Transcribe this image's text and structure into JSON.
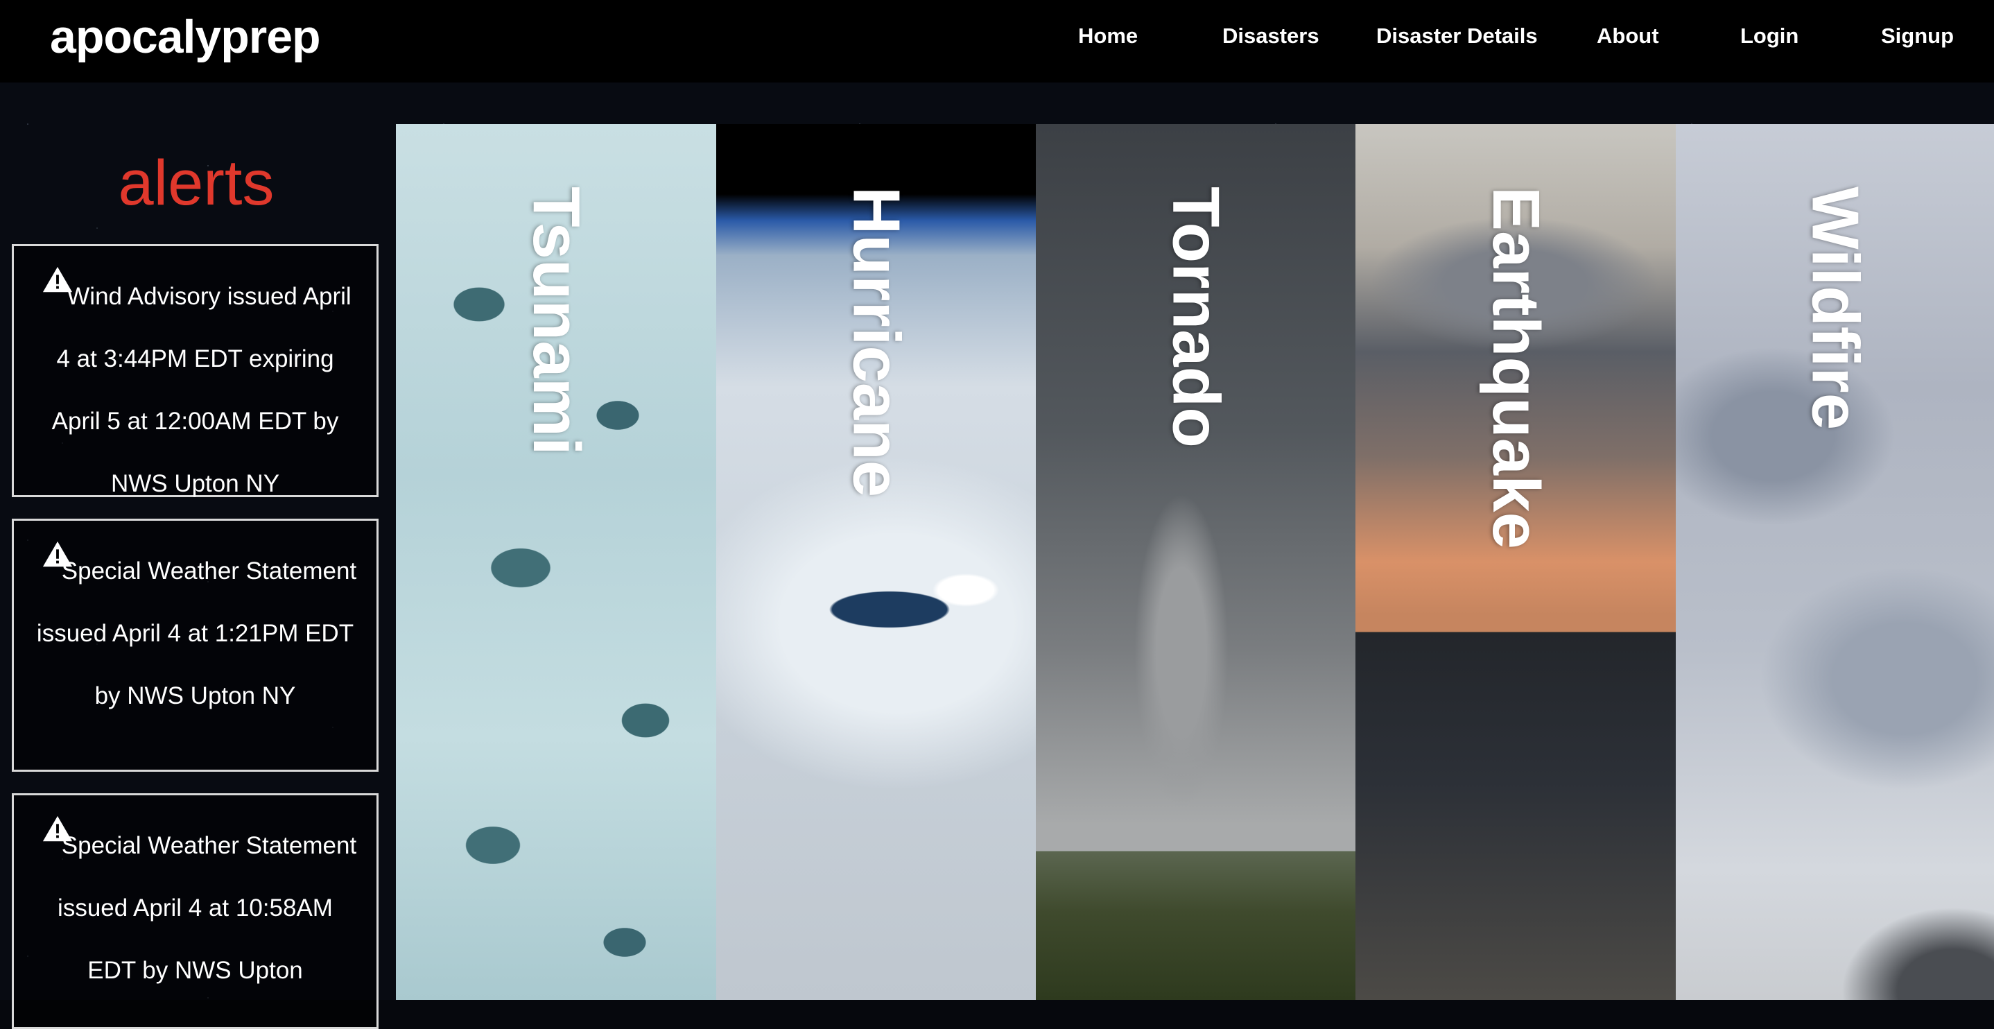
{
  "site": {
    "logo": "apocalyprep"
  },
  "nav": {
    "home": "Home",
    "disasters": "Disasters",
    "disaster_details": "Disaster Details",
    "about": "About",
    "login": "Login",
    "signup": "Signup"
  },
  "alerts": {
    "title": "alerts",
    "items": [
      {
        "icon": "warning-icon",
        "text": "Wind Advisory issued April 4 at 3:44PM EDT expiring April 5 at 12:00AM EDT by NWS Upton NY"
      },
      {
        "icon": "warning-icon",
        "text": "Special Weather Statement issued April 4 at 1:21PM EDT by NWS Upton NY"
      },
      {
        "icon": "warning-icon",
        "text": "Special Weather Statement issued April 4 at 10:58AM EDT by NWS Upton"
      }
    ]
  },
  "disasters": [
    {
      "label": "Tsunami"
    },
    {
      "label": "Hurricane"
    },
    {
      "label": "Tornado"
    },
    {
      "label": "Earthquake"
    },
    {
      "label": "Wildfire"
    }
  ],
  "colors": {
    "header_bg": "#000000",
    "alerts_title": "#e0382c",
    "alert_border": "#d9d9d9"
  }
}
